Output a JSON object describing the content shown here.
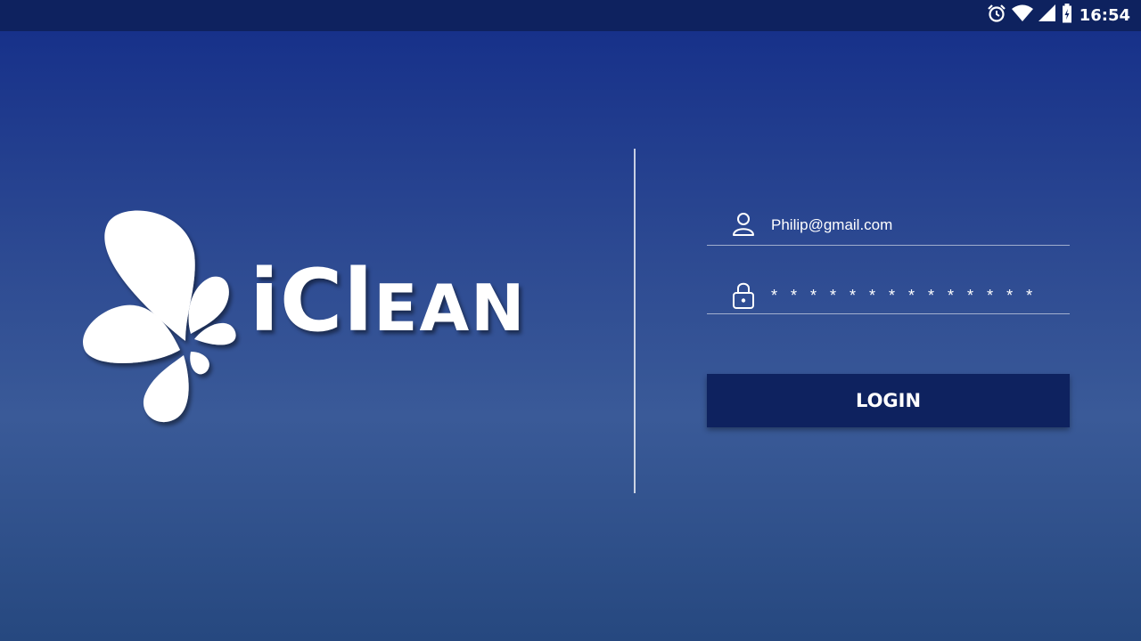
{
  "status_bar": {
    "time": "16:54",
    "icons": [
      "alarm-icon",
      "wifi-icon",
      "cellular-signal-icon",
      "battery-icon"
    ]
  },
  "logo": {
    "wordmark_prefix": "iCl",
    "wordmark_suffix": "EAN",
    "icon": "flower-logo-icon"
  },
  "form": {
    "email": {
      "icon": "user-icon",
      "value": "Philip@gmail.com"
    },
    "password": {
      "icon": "lock-icon",
      "value": "* * * * * * * * * * * * * *"
    },
    "login_label": "LOGIN"
  },
  "colors": {
    "status_bar": "#0e225f",
    "background_top": "#17318a",
    "background_mid": "#3a5a98",
    "button": "#0e225f",
    "text": "#ffffff"
  }
}
